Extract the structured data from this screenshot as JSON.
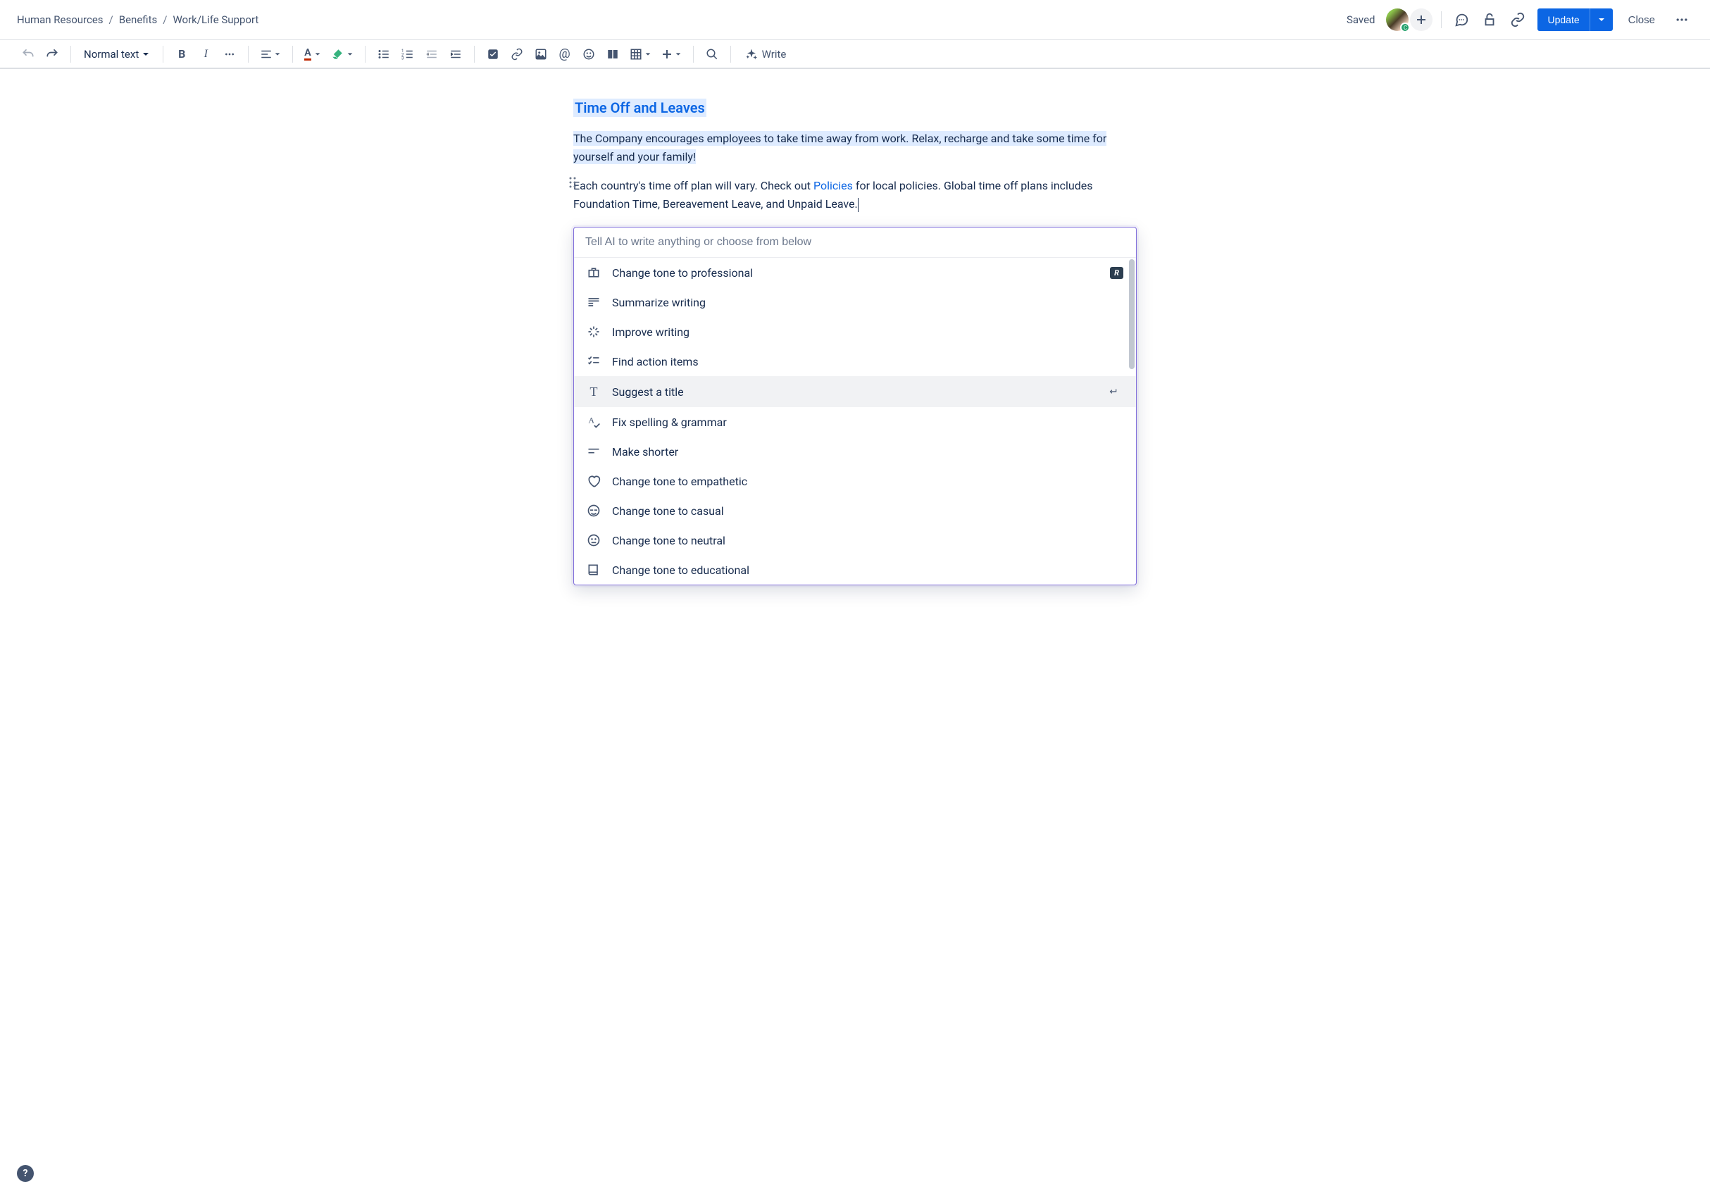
{
  "breadcrumbs": [
    "Human Resources",
    "Benefits",
    "Work/Life Support"
  ],
  "header": {
    "saved": "Saved",
    "avatar_badge": "C",
    "update": "Update",
    "close": "Close"
  },
  "toolbar": {
    "text_style": "Normal text",
    "write": "Write"
  },
  "document": {
    "heading": "Time Off and Leaves",
    "para1": "The Company encourages employees to take time away from work. Relax, recharge and take some time for yourself and your family!",
    "para2_a": "Each country's time off plan will vary. Check out ",
    "para2_link": "Policies",
    "para2_b": " for local policies. Global time off plans includes Foundation Time, Bereavement Leave, and Unpaid Leave."
  },
  "ai": {
    "placeholder": "Tell AI to write anything or choose from below",
    "items": [
      {
        "label": "Change tone to professional",
        "icon": "briefcase",
        "badge": "R"
      },
      {
        "label": "Summarize writing",
        "icon": "summary"
      },
      {
        "label": "Improve writing",
        "icon": "sparkle"
      },
      {
        "label": "Find action items",
        "icon": "checklist"
      },
      {
        "label": "Suggest a title",
        "icon": "title",
        "selected": true,
        "enter": true
      },
      {
        "label": "Fix spelling & grammar",
        "icon": "spellcheck"
      },
      {
        "label": "Make shorter",
        "icon": "shorter"
      },
      {
        "label": "Change tone to empathetic",
        "icon": "heart"
      },
      {
        "label": "Change tone to casual",
        "icon": "cool"
      },
      {
        "label": "Change tone to neutral",
        "icon": "neutral"
      },
      {
        "label": "Change tone to educational",
        "icon": "book"
      }
    ]
  },
  "help": "?"
}
